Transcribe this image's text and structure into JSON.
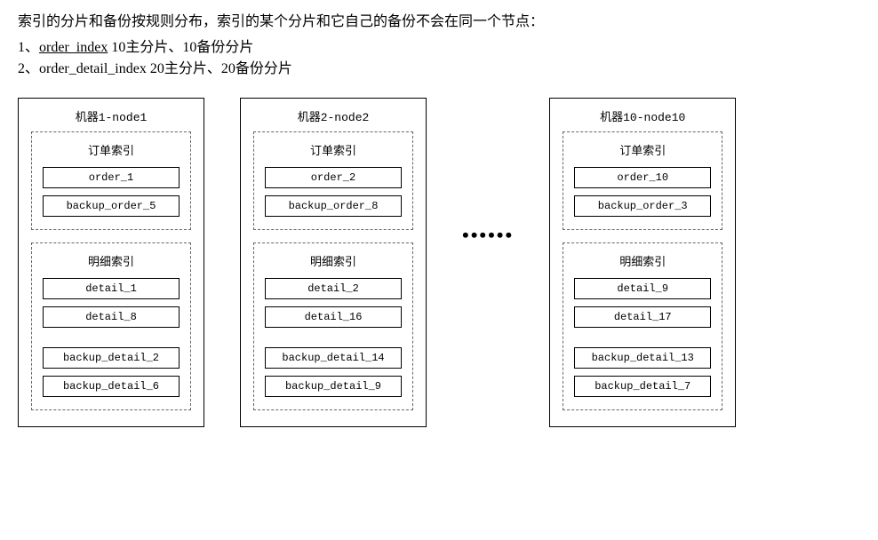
{
  "header": {
    "mainText": "索引的分片和备份按规则分布，索引的某个分片和它自己的备份不会在同一个节点：",
    "line1_prefix": "1、",
    "line1_underline": "order_index",
    "line1_suffix": "  10主分片、10备份分片",
    "line2": "2、order_detail_index  20主分片、20备份分片"
  },
  "ellipsis": "••••••",
  "nodes": [
    {
      "title": "机器1-node1",
      "orderIndex": {
        "title": "订单索引",
        "shards": [
          "order_1",
          "backup_order_5"
        ]
      },
      "detailIndex": {
        "title": "明细索引",
        "shardsTop": [
          "detail_1",
          "detail_8"
        ],
        "shardsBottom": [
          "backup_detail_2",
          "backup_detail_6"
        ]
      }
    },
    {
      "title": "机器2-node2",
      "orderIndex": {
        "title": "订单索引",
        "shards": [
          "order_2",
          "backup_order_8"
        ]
      },
      "detailIndex": {
        "title": "明细索引",
        "shardsTop": [
          "detail_2",
          "detail_16"
        ],
        "shardsBottom": [
          "backup_detail_14",
          "backup_detail_9"
        ]
      }
    },
    {
      "title": "机器10-node10",
      "orderIndex": {
        "title": "订单索引",
        "shards": [
          "order_10",
          "backup_order_3"
        ]
      },
      "detailIndex": {
        "title": "明细索引",
        "shardsTop": [
          "detail_9",
          "detail_17"
        ],
        "shardsBottom": [
          "backup_detail_13",
          "backup_detail_7"
        ]
      }
    }
  ]
}
